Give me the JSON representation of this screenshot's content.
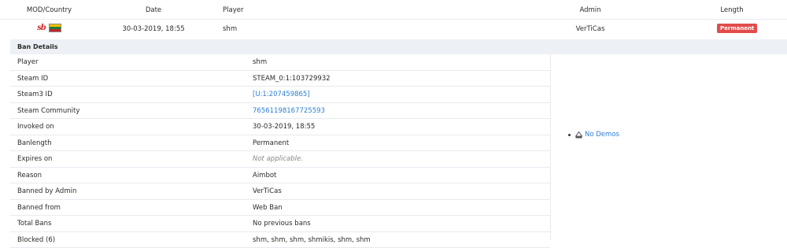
{
  "table": {
    "headers": {
      "mod_country": "MOD/Country",
      "date": "Date",
      "player": "Player",
      "admin": "Admin",
      "length": "Length"
    },
    "row": {
      "mod_logo_text": "sb",
      "date": "30-03-2019, 18:55",
      "player": "shm",
      "admin": "VerTiCas",
      "length_badge": "Permanent",
      "badge_color": "#e24c4b"
    }
  },
  "details": {
    "title": "Ban Details",
    "rows": [
      {
        "label": "Player",
        "value": "shm"
      },
      {
        "label": "Steam ID",
        "value": "STEAM_0:1:103729932"
      },
      {
        "label": "Steam3 ID",
        "value": "[U:1:207459865]"
      },
      {
        "label": "Steam Community",
        "value": "76561198167725593"
      },
      {
        "label": "Invoked on",
        "value": "30-03-2019, 18:55"
      },
      {
        "label": "Banlength",
        "value": "Permanent"
      },
      {
        "label": "Expires on",
        "value": "Not applicable."
      },
      {
        "label": "Reason",
        "value": "Aimbot"
      },
      {
        "label": "Banned by Admin",
        "value": "VerTiCas"
      },
      {
        "label": "Banned from",
        "value": "Web Ban"
      },
      {
        "label": "Total Bans",
        "value": "No previous bans"
      },
      {
        "label": "Blocked (6)",
        "value": "shm, shm, shm, shmikis, shm, shm"
      }
    ],
    "demos": {
      "icon": "demo-icon",
      "label": "No Demos"
    }
  },
  "colors": {
    "link": "#2d7fd3",
    "header_bg": "#edf1f6"
  }
}
